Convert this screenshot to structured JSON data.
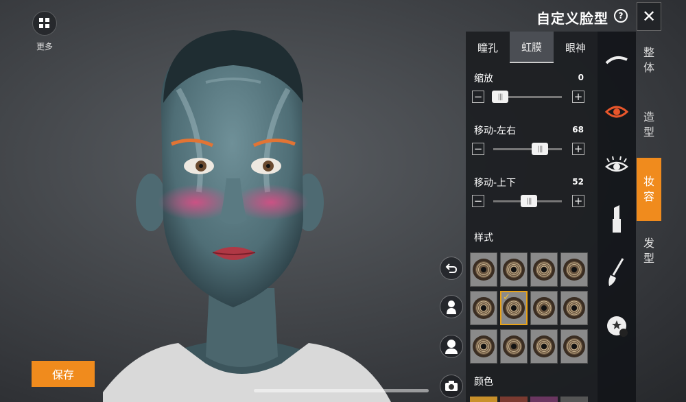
{
  "header": {
    "title": "自定义脸型",
    "help_symbol": "?",
    "close_symbol": "✕"
  },
  "top_left": {
    "more_label": "更多"
  },
  "subtabs": [
    {
      "label": "瞳孔"
    },
    {
      "label": "虹膜",
      "active": true
    },
    {
      "label": "眼神"
    }
  ],
  "sliders": [
    {
      "label": "缩放",
      "value": "0",
      "fraction": 0.1
    },
    {
      "label": "移动-左右",
      "value": "68",
      "fraction": 0.68
    },
    {
      "label": "移动-上下",
      "value": "52",
      "fraction": 0.52
    }
  ],
  "style_section": {
    "label": "样式",
    "selected_index": 5
  },
  "color_section": {
    "label": "颜色"
  },
  "right_tabs": [
    {
      "label": "整体"
    },
    {
      "label": "造型"
    },
    {
      "label": "妆容",
      "active": true
    },
    {
      "label": "发型"
    }
  ],
  "category_icons": [
    "eyebrow-icon",
    "eye-icon",
    "eyelash-icon",
    "lipstick-icon",
    "brush-icon",
    "sticker-icon"
  ],
  "save_label": "保存",
  "colors": {
    "accent": "#f08b1d",
    "selected_swatch": "#e7a21a",
    "active_icon": "#e8562b"
  }
}
